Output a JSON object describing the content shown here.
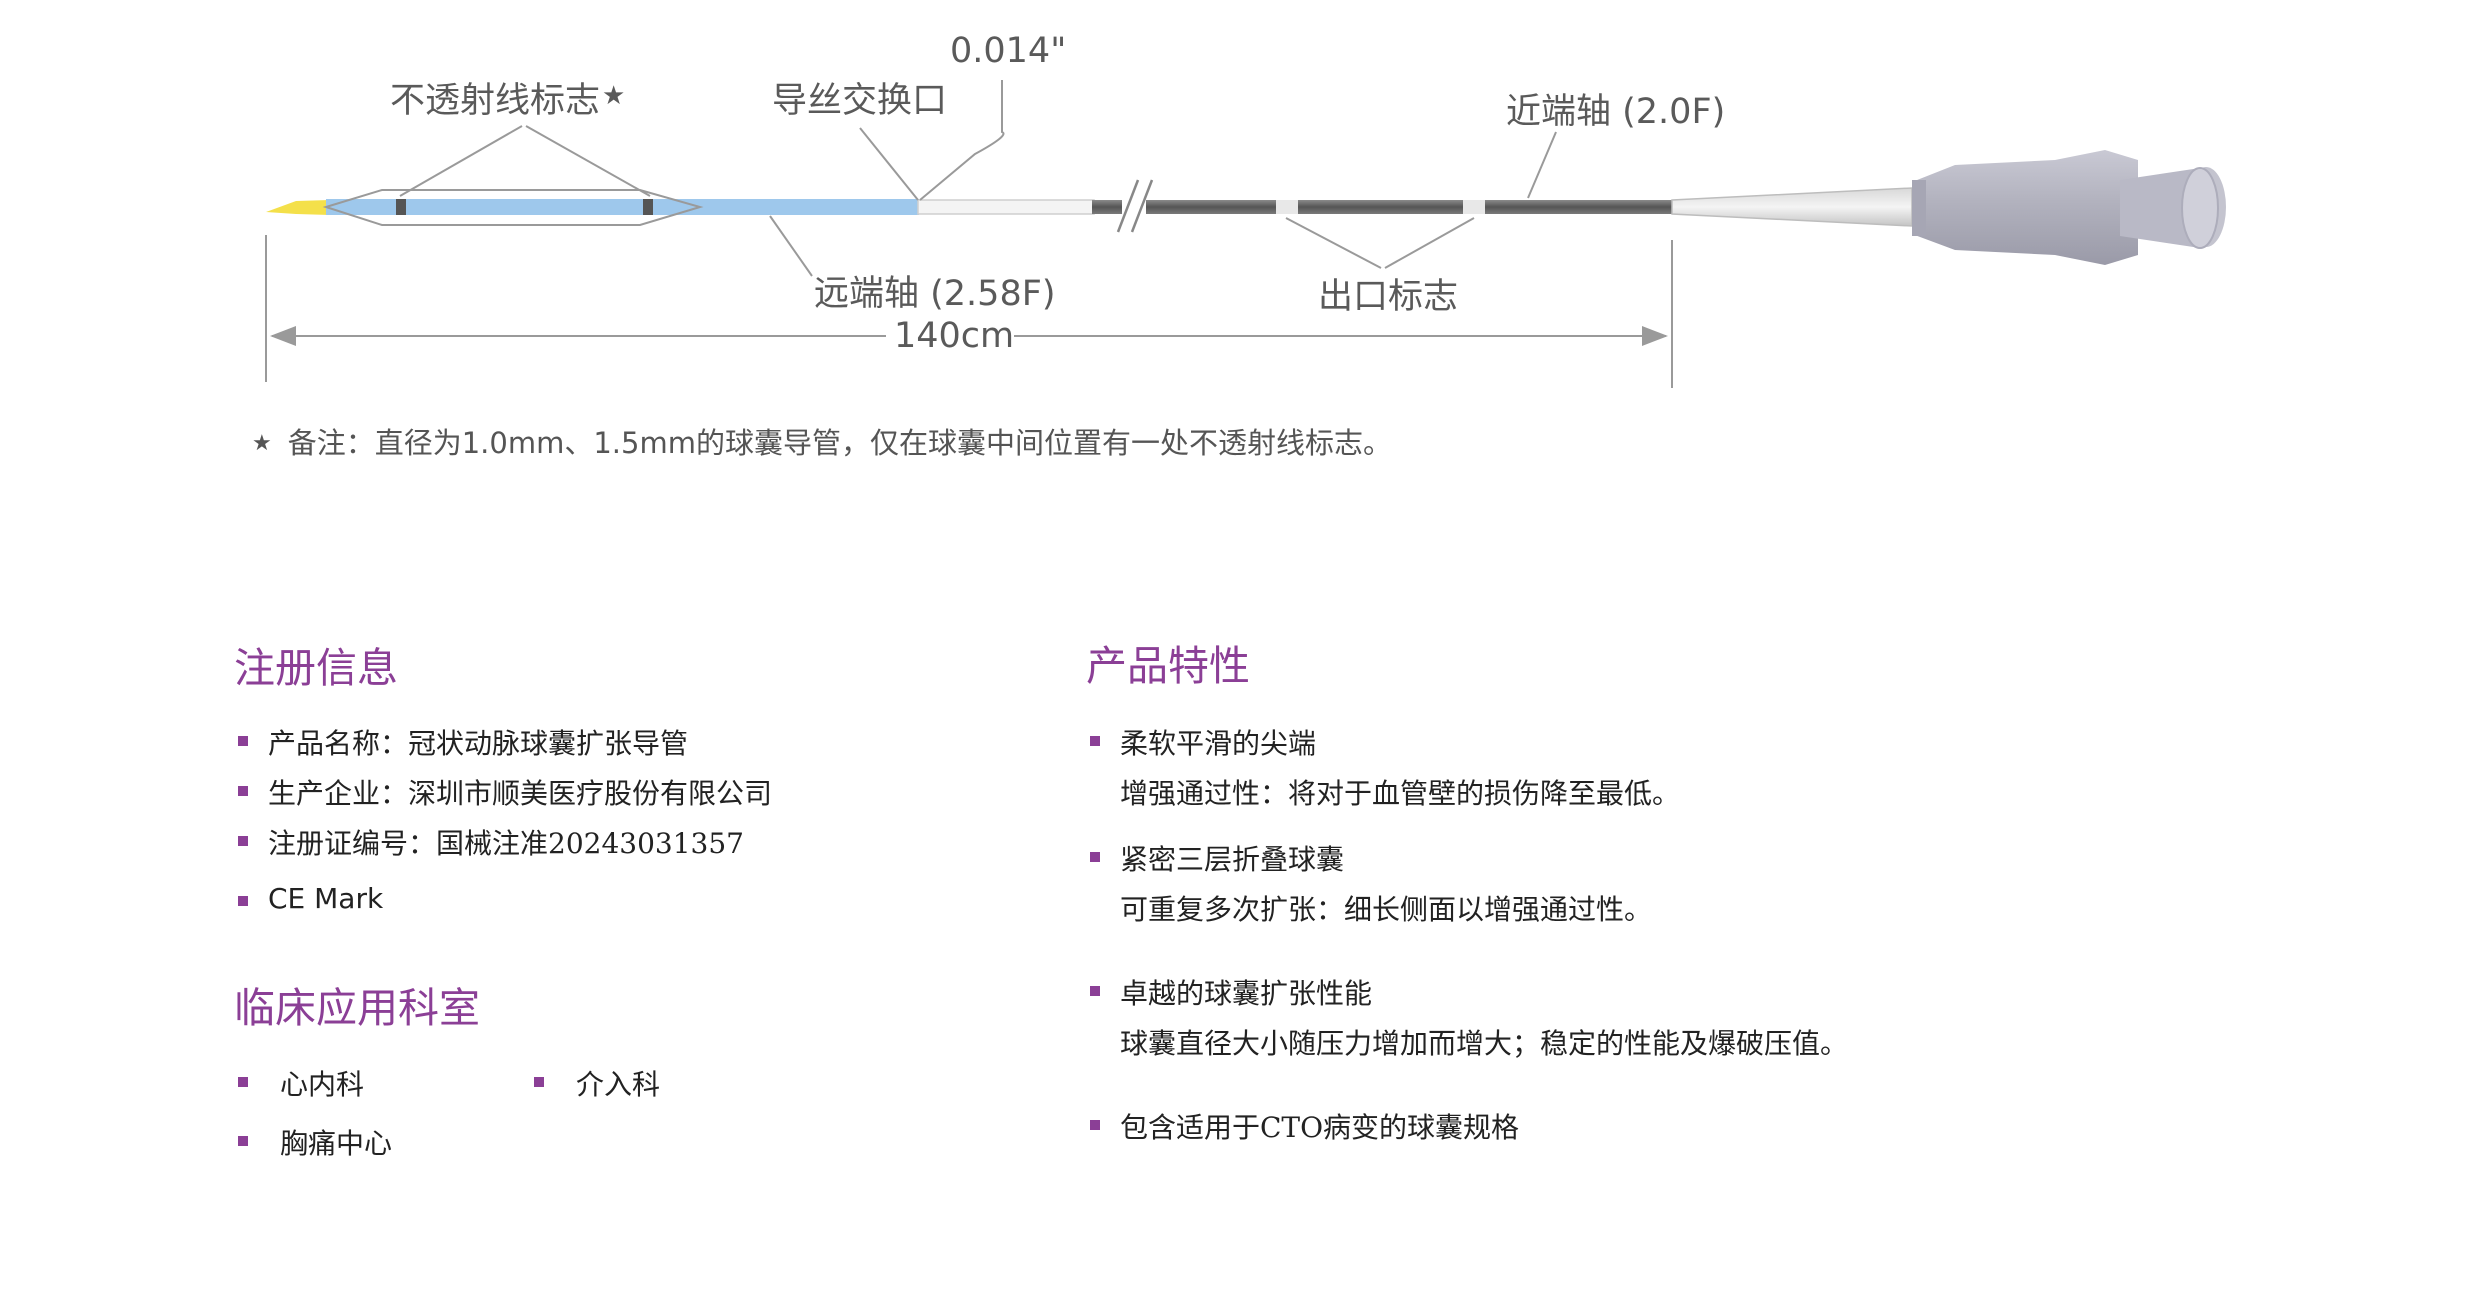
{
  "diagram": {
    "labels": {
      "marker": "不透射线标志",
      "marker_star": "★",
      "wire_port": "导丝交换口",
      "wire_size": "0.014\"",
      "proximal_shaft": "近端轴 (2.0F)",
      "distal_shaft": "远端轴 (2.58F)",
      "exit_marker": "出口标志",
      "length": "140cm"
    },
    "note_star": "★",
    "note": "备注：直径为1.0mm、1.5mm的球囊导管，仅在球囊中间位置有一处不透射线标志。",
    "colors": {
      "tip": "#f4e04a",
      "distal_shaft": "#9ec8ec",
      "proximal_shaft": "#6e6e6e",
      "hub": "#b4b4c0",
      "accent": "#8b3f96"
    }
  },
  "registration": {
    "title": "注册信息",
    "items": [
      "产品名称：冠状动脉球囊扩张导管",
      "生产企业：深圳市顺美医疗股份有限公司",
      "注册证编号：国械注准20243031357",
      "CE Mark"
    ]
  },
  "clinical": {
    "title": "临床应用科室",
    "items": [
      "心内科",
      "介入科",
      "胸痛中心"
    ]
  },
  "features": {
    "title": "产品特性",
    "items": [
      {
        "head": "柔软平滑的尖端",
        "sub": "增强通过性：将对于血管壁的损伤降至最低。"
      },
      {
        "head": "紧密三层折叠球囊",
        "sub": "可重复多次扩张：细长侧面以增强通过性。"
      },
      {
        "head": "卓越的球囊扩张性能",
        "sub": "球囊直径大小随压力增加而增大；稳定的性能及爆破压值。"
      },
      {
        "head": "包含适用于CTO病变的球囊规格",
        "sub": ""
      }
    ]
  }
}
